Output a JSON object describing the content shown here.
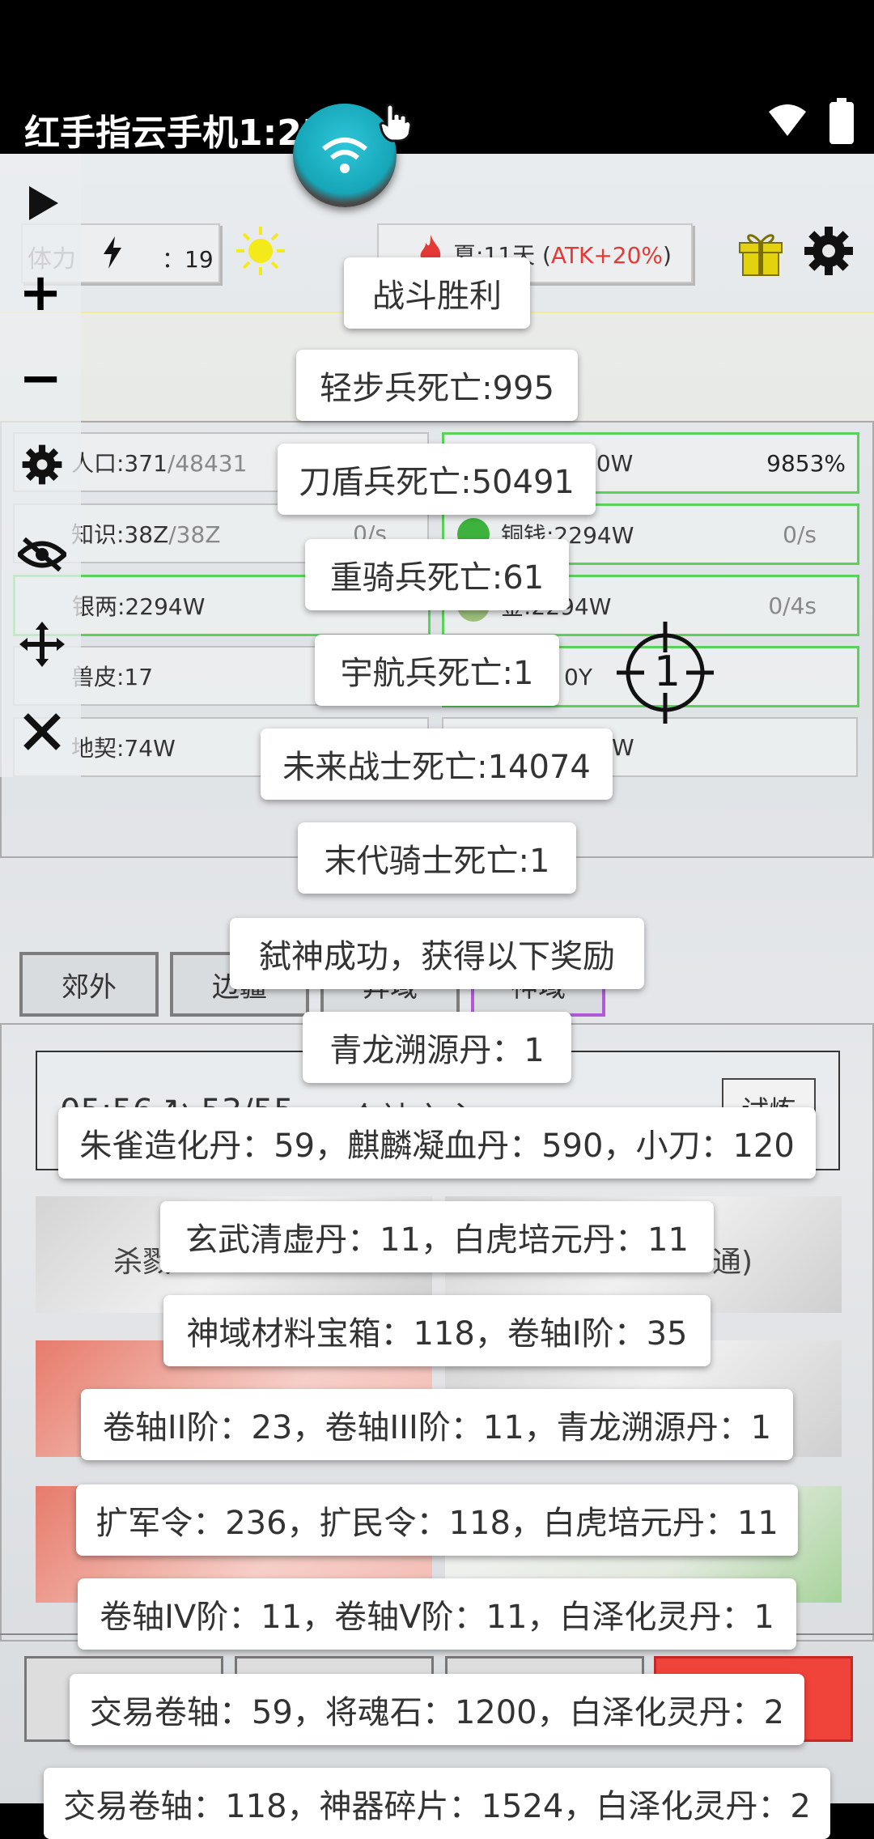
{
  "status_bar": {
    "title": "红手指云手机1:25"
  },
  "hud": {
    "stamina_label": "体力",
    "stamina_value": "：19",
    "season_prefix": "夏:11天 (",
    "season_atk": "ATK+20%",
    "season_suffix": ")"
  },
  "resources": [
    {
      "label": "人口:371",
      "suffix": "/48431",
      "rate": "",
      "pct": ""
    },
    {
      "label": "60W",
      "suffix": "",
      "rate": "",
      "pct": "9853%"
    },
    {
      "label": "知识:38Z",
      "suffix": "/38Z",
      "rate": "0/s",
      "pct": ""
    },
    {
      "label": "铜钱:2294W",
      "suffix": "",
      "rate": "0/s",
      "pct": ""
    },
    {
      "label": "银两:2294W",
      "suffix": "",
      "rate": "",
      "pct": ""
    },
    {
      "label": "金:2294W",
      "suffix": "",
      "rate": "0/4s",
      "pct": ""
    },
    {
      "label": "兽皮:17",
      "suffix": "",
      "rate": "",
      "pct": ""
    },
    {
      "label": "0Y",
      "suffix": "",
      "rate": "",
      "pct": ""
    },
    {
      "label": "地契:74W",
      "suffix": "",
      "rate": "",
      "pct": ""
    },
    {
      "label": "W",
      "suffix": "",
      "rate": "",
      "pct": ""
    }
  ],
  "crosshair_number": "1",
  "tabs": [
    "郊外",
    "边疆",
    "异域",
    "神域"
  ],
  "timer": {
    "text": "05:56 ↻ 53/55",
    "center": "众神之主",
    "trial": "试炼"
  },
  "cards": [
    "杀戮",
    "通)"
  ],
  "toasts": [
    "战斗胜利",
    "轻步兵死亡:995",
    "刀盾兵死亡:50491",
    "重骑兵死亡:61",
    "宇航兵死亡:1",
    "未来战士死亡:14074",
    "末代骑士死亡:1",
    "弑神成功，获得以下奖励",
    "青龙溯源丹：1",
    "朱雀造化丹：59，麒麟凝血丹：590，小刀：120",
    "玄武清虚丹：11，白虎培元丹：11",
    "神域材料宝箱：118，卷轴I阶：35",
    "卷轴II阶：23，卷轴III阶：11，青龙溯源丹：1",
    "扩军令：236，扩民令：118，白虎培元丹：11",
    "卷轴IV阶：11，卷轴V阶：11，白泽化灵丹：1",
    "交易卷轴：59，将魂石：1200，白泽化灵丹：2",
    "交易卷轴：118，神器碎片：1524，白泽化灵丹：2"
  ],
  "colors": {
    "accent_red": "#e53935",
    "green_border": "#5ad25a",
    "tab_purple": "#b05ad8"
  }
}
